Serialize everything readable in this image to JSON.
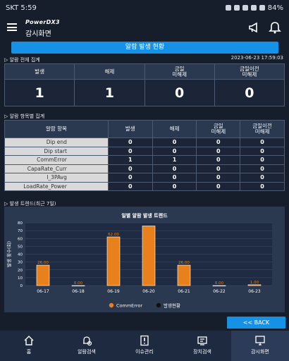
{
  "status_bar": {
    "carrier_time": "SKT 5:59",
    "battery": "84%"
  },
  "app": {
    "brand": "PowerDX3",
    "title": "감시화면"
  },
  "banner": {
    "label": "알람 발생 현황"
  },
  "datetime": "2023-06-23 17:59:03",
  "summary": {
    "section_title": "▷ 알람 전체 집계",
    "headers": [
      "발생",
      "해제",
      "금일\n미해제",
      "금일이전\n미해제"
    ],
    "values": [
      "1",
      "1",
      "0",
      "0"
    ]
  },
  "items": {
    "section_title": "▷ 알람 항목별 집계",
    "headers": [
      "알람 항목",
      "발생",
      "해제",
      "금일\n미해제",
      "금일이전\n미해제"
    ],
    "rows": [
      {
        "name": "Dip end",
        "values": [
          "0",
          "0",
          "0",
          "0"
        ]
      },
      {
        "name": "Dip start",
        "values": [
          "0",
          "0",
          "0",
          "0"
        ]
      },
      {
        "name": "CommError",
        "values": [
          "1",
          "1",
          "0",
          "0"
        ]
      },
      {
        "name": "CapaRate_Curr",
        "values": [
          "0",
          "0",
          "0",
          "0"
        ]
      },
      {
        "name": "I_3PAvg",
        "values": [
          "0",
          "0",
          "0",
          "0"
        ]
      },
      {
        "name": "LoadRate_Power",
        "values": [
          "0",
          "0",
          "0",
          "0"
        ]
      }
    ]
  },
  "trend": {
    "section_title": "▷ 발생 트렌드(최근 7일)"
  },
  "chart_data": {
    "type": "bar",
    "title": "일별 알람 발생 트렌드",
    "ylabel": "발생 횟수(회)",
    "xlabel": "",
    "categories": [
      "06-17",
      "06-18",
      "06-19",
      "06-20",
      "06-21",
      "06-22",
      "06-23"
    ],
    "series": [
      {
        "name": "CommError",
        "color": "#e8811c",
        "values": [
          26,
          0,
          62,
          76,
          26,
          0,
          1
        ]
      },
      {
        "name": "발생현황",
        "color": "#111111",
        "values": [
          null,
          null,
          null,
          null,
          null,
          null,
          null
        ]
      }
    ],
    "data_labels": [
      "26.00",
      "0.00",
      "62.00",
      "",
      "26.00",
      "0.00",
      "1.00"
    ],
    "ylim": [
      0,
      80
    ],
    "yticks": [
      "0",
      "10",
      "20",
      "30",
      "40",
      "50",
      "60",
      "70",
      "80"
    ],
    "grid": true,
    "legend": "bottom"
  },
  "back_button": {
    "label": "<< BACK"
  },
  "nav": [
    {
      "label": "홈",
      "icon": "home-icon"
    },
    {
      "label": "알람검색",
      "icon": "alarm-search-icon"
    },
    {
      "label": "이슈관리",
      "icon": "issue-icon"
    },
    {
      "label": "장치검색",
      "icon": "device-icon"
    },
    {
      "label": "감시화면",
      "icon": "monitor-icon"
    }
  ]
}
